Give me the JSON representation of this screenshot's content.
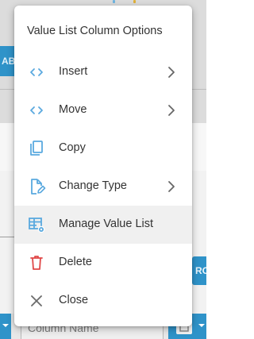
{
  "background": {
    "left_button_label": "AB",
    "right_button_label": "RO",
    "column_name_placeholder": "Column Name"
  },
  "menu": {
    "title": "Value List Column Options",
    "items": [
      {
        "label": "Insert",
        "icon": "code-brackets-icon",
        "has_submenu": true
      },
      {
        "label": "Move",
        "icon": "code-brackets-icon",
        "has_submenu": true
      },
      {
        "label": "Copy",
        "icon": "copy-icon",
        "has_submenu": false
      },
      {
        "label": "Change Type",
        "icon": "edit-document-icon",
        "has_submenu": true
      },
      {
        "label": "Manage Value List",
        "icon": "table-settings-icon",
        "has_submenu": false,
        "highlighted": true
      },
      {
        "label": "Delete",
        "icon": "trash-icon",
        "has_submenu": false
      },
      {
        "label": "Close",
        "icon": "close-icon",
        "has_submenu": false
      }
    ]
  },
  "colors": {
    "accent_blue": "#2f93c9",
    "icon_light_blue": "#5aa9df",
    "delete_red": "#e04848",
    "text": "#333333",
    "highlight": "#f0f0f0"
  }
}
